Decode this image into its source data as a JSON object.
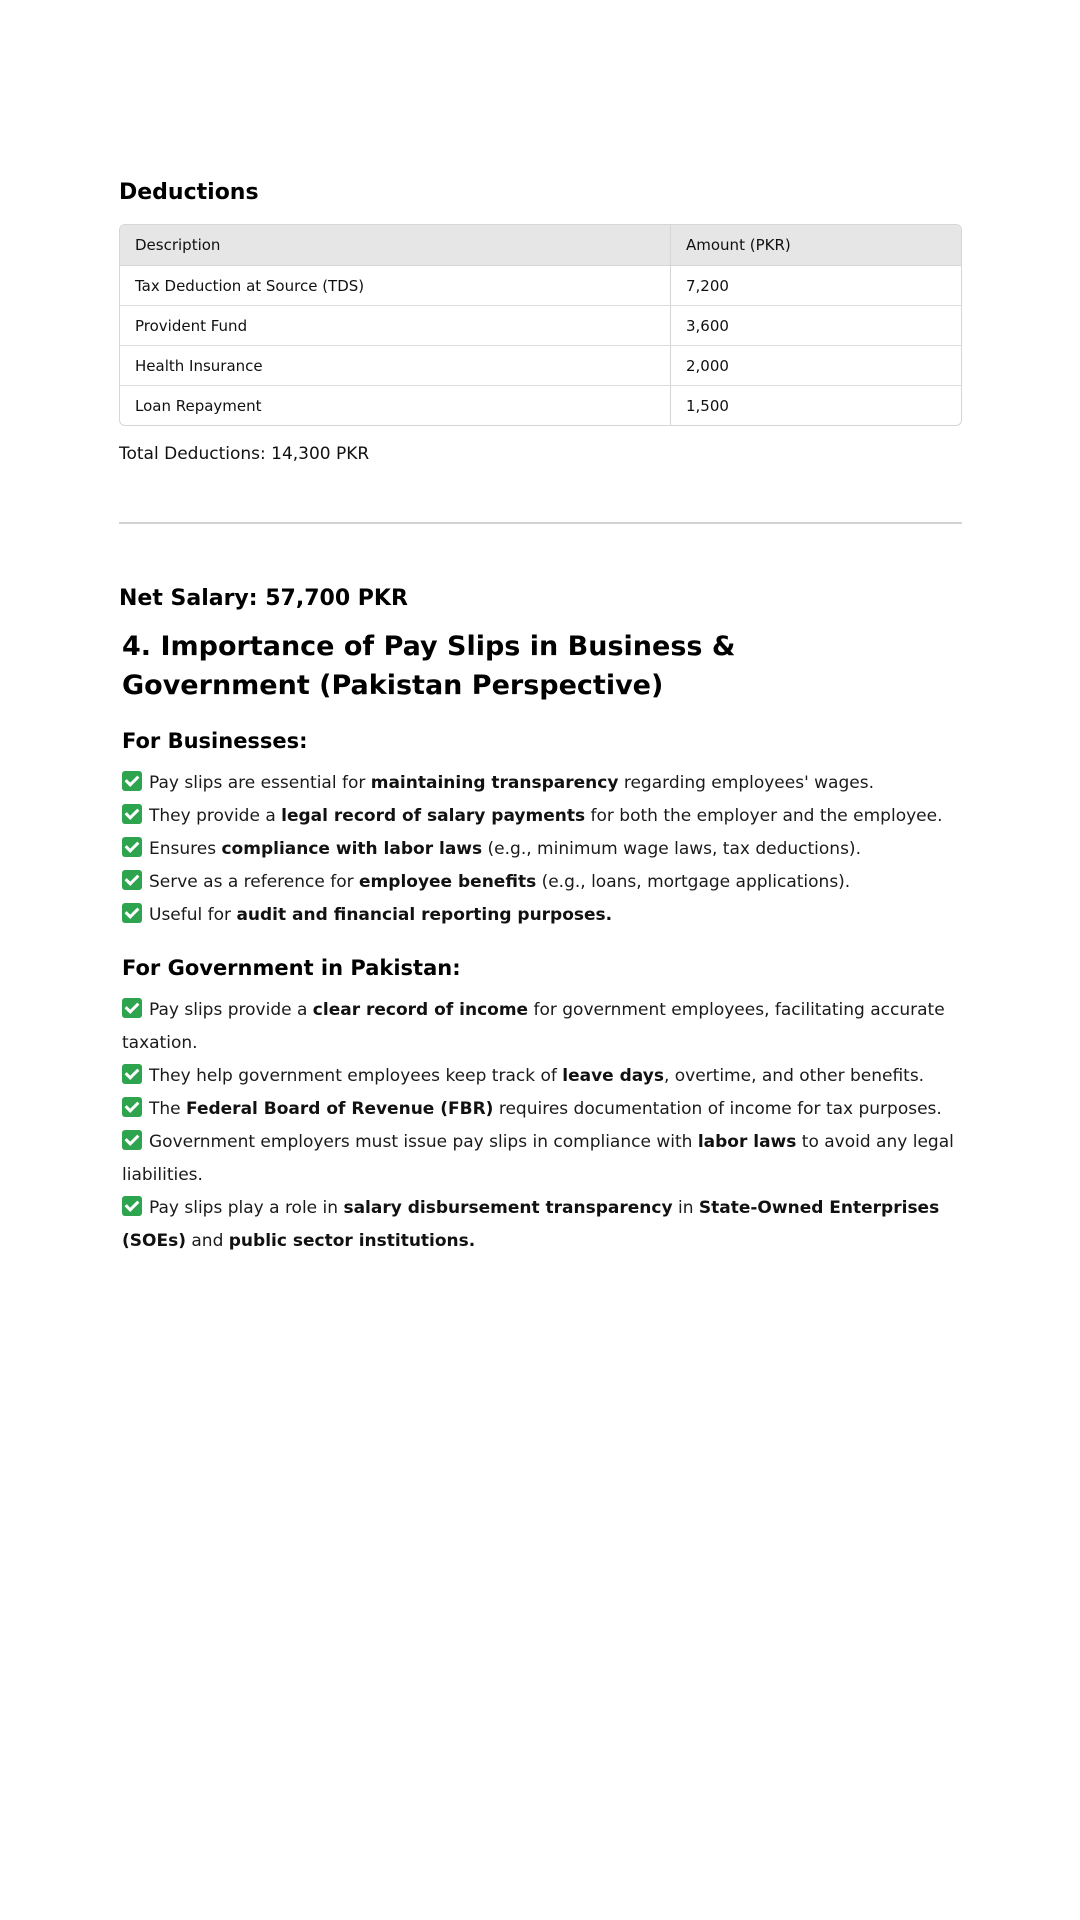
{
  "deductions": {
    "heading": "Deductions",
    "table": {
      "headers": [
        "Description",
        "Amount (PKR)"
      ],
      "rows": [
        [
          "Tax Deduction at Source (TDS)",
          "7,200"
        ],
        [
          "Provident Fund",
          "3,600"
        ],
        [
          "Health Insurance",
          "2,000"
        ],
        [
          "Loan Repayment",
          "1,500"
        ]
      ]
    },
    "total_label": "Total Deductions:",
    "total_value": "14,300 PKR"
  },
  "net_salary": {
    "label": "Net Salary:",
    "value": "57,700 PKR"
  },
  "importance": {
    "title": "4. Importance of Pay Slips in Business & Government (Pakistan Perspective)",
    "businesses": {
      "heading": "For Businesses:",
      "items": [
        {
          "pre": "Pay slips are essential for ",
          "bold": "maintaining transparency",
          "post": " regarding employees' wages."
        },
        {
          "pre": "They provide a ",
          "bold": "legal record of salary payments",
          "post": " for both the employer and the employee."
        },
        {
          "pre": "Ensures ",
          "bold": "compliance with labor laws",
          "post": " (e.g., minimum wage laws, tax deductions)."
        },
        {
          "pre": "Serve as a reference for ",
          "bold": "employee benefits",
          "post": " (e.g., loans, mortgage applications)."
        },
        {
          "pre": "Useful for ",
          "bold": "audit and financial reporting purposes.",
          "post": ""
        }
      ]
    },
    "government": {
      "heading": "For Government in Pakistan:",
      "items": [
        {
          "pre": "Pay slips provide a ",
          "bold": "clear record of income",
          "post": " for government employees, facilitating accurate taxation."
        },
        {
          "pre": "They help government employees keep track of ",
          "bold": "leave days",
          "post": ", overtime, and other benefits."
        },
        {
          "pre": "The ",
          "bold": "Federal Board of Revenue (FBR)",
          "post": " requires documentation of income for tax purposes."
        },
        {
          "pre": "Government employers must issue pay slips in compliance with ",
          "bold": "labor laws",
          "post": " to avoid any legal liabilities."
        },
        {
          "pre": "Pay slips play a role in ",
          "bold": "salary disbursement transparency",
          "mid": " in ",
          "bold2": "State-Owned Enterprises (SOEs)",
          "mid2": " and ",
          "bold3": "public sector institutions.",
          "post": ""
        }
      ]
    }
  }
}
